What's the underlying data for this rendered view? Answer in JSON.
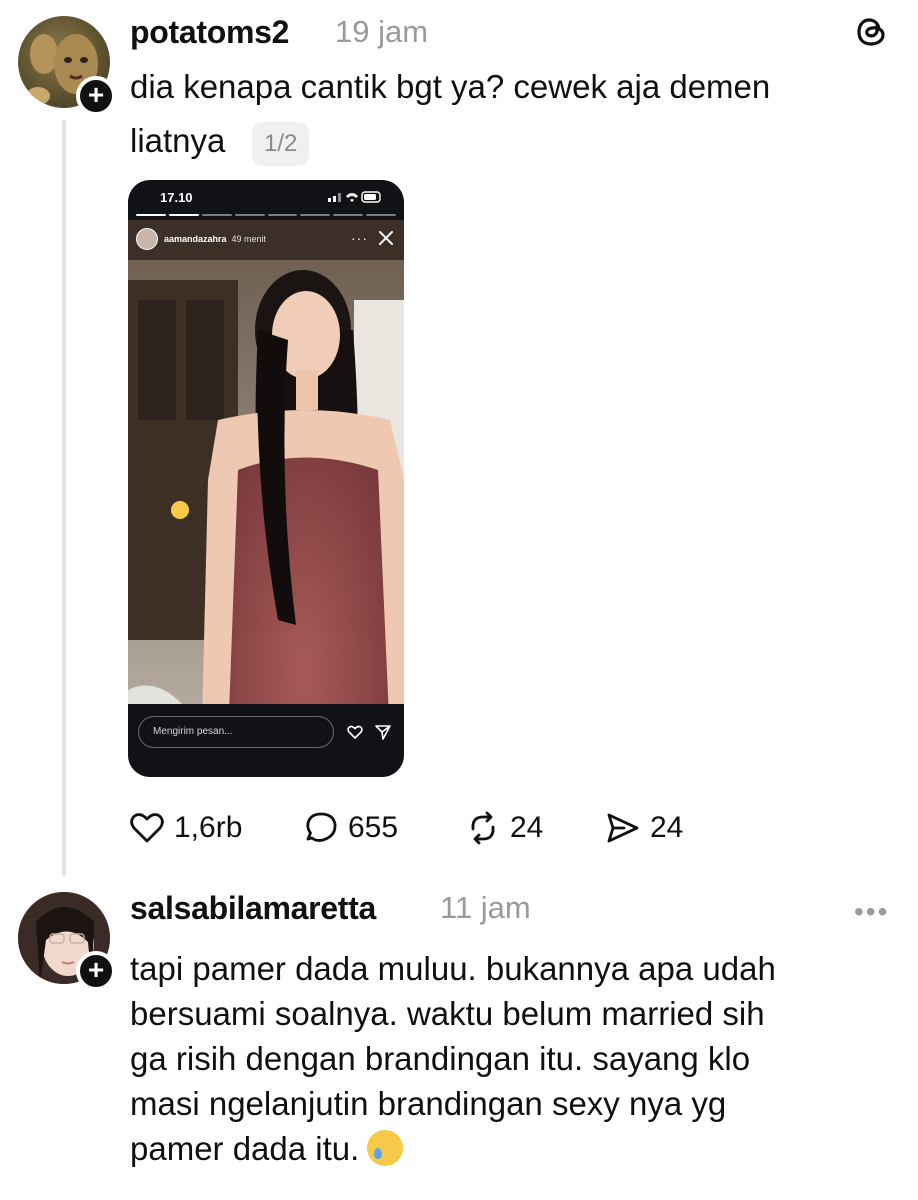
{
  "post": {
    "username": "potatoms2",
    "time": "19 jam",
    "text_line1": "dia kenapa cantik bgt ya? cewek aja demen",
    "text_line2": "liatnya",
    "page_indicator": "1/2",
    "story": {
      "status_time": "17.10",
      "username": "aamandazahra",
      "ago": "49 menit",
      "more": "···",
      "message_placeholder": "Mengirim pesan..."
    },
    "actions": {
      "likes": "1,6rb",
      "replies": "655",
      "reposts": "24",
      "shares": "24"
    }
  },
  "reply": {
    "username": "salsabilamaretta",
    "time": "11 jam",
    "lines": [
      "tapi pamer dada muluu. bukannya apa udah",
      "bersuami soalnya. waktu belum married sih",
      "ga risih dengan brandingan itu. sayang klo",
      "masi ngelanjutin brandingan sexy nya yg",
      "pamer dada itu."
    ]
  },
  "icons": {
    "app": "threads-icon",
    "more": "more-icon",
    "like": "heart-icon",
    "reply": "comment-icon",
    "repost": "repost-icon",
    "share": "send-icon",
    "emoji": "face-holding-back-tears-emoji"
  },
  "colors": {
    "text": "#101010",
    "muted": "#9a9a9a",
    "thread_line": "#e3e3e3",
    "story_background": "#111216"
  }
}
